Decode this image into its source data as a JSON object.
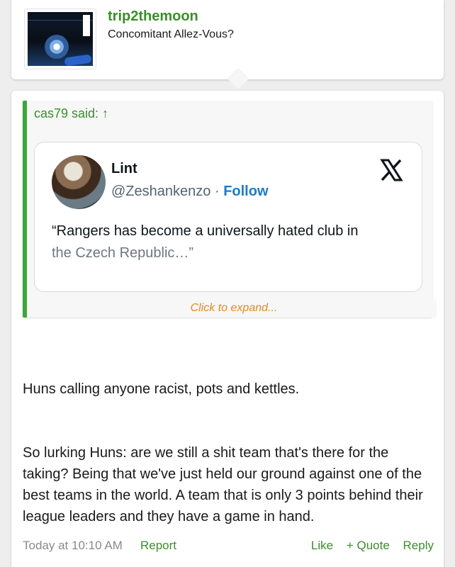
{
  "user": {
    "username": "trip2themoon",
    "title": "Concomitant Allez-Vous?",
    "avatar_icon": "album-cover-avatar"
  },
  "quote": {
    "attribution": "cas79 said: ↑",
    "expand_label": "Click to expand...",
    "accent_color": "#3aa83a"
  },
  "tweet": {
    "name": "Lint",
    "handle": "@Zeshankenzo",
    "separator": "·",
    "follow_label": "Follow",
    "text_line1": "“Rangers has become a universally hated club in",
    "text_line2": "the Czech Republic…”",
    "icon": "x-logo-icon"
  },
  "message": {
    "paragraph1": "Huns calling anyone racist, pots and kettles.",
    "paragraph2": "So lurking Huns: are we still a shit team that's there for the taking? Being that we've just held our ground against one of the best teams in the world. A team that is only 3 points behind their league leaders and they have a game in hand."
  },
  "footer": {
    "timestamp": "Today at 10:10 AM",
    "report_label": "Report",
    "like_label": "Like",
    "quote_label": "+ Quote",
    "reply_label": "Reply"
  },
  "colors": {
    "accent_green": "#3a8e2a",
    "expand_orange": "#e08a1e",
    "follow_blue": "#1d7bc4"
  }
}
